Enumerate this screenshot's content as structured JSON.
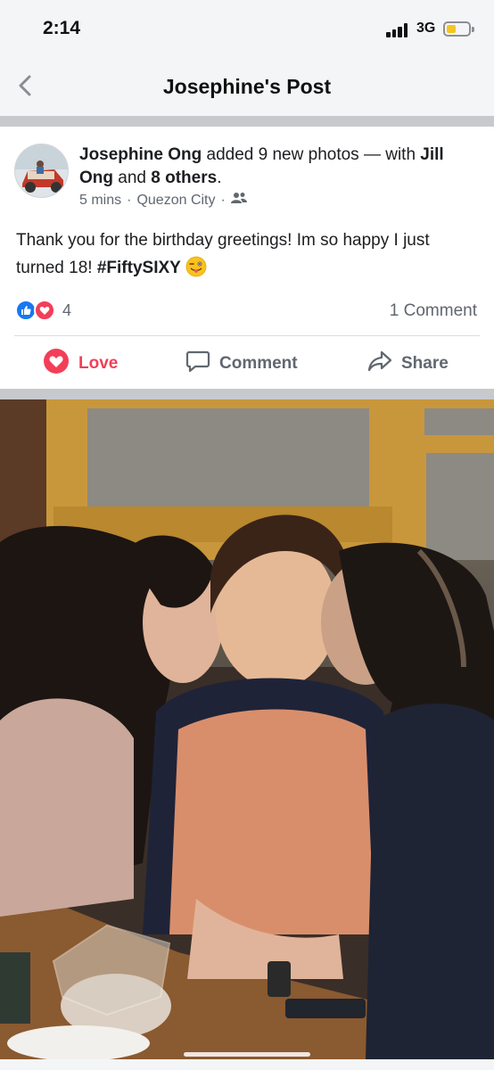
{
  "status": {
    "time": "2:14",
    "network": "3G"
  },
  "nav": {
    "title": "Josephine's Post"
  },
  "post": {
    "author": "Josephine Ong",
    "action_text": " added 9 new photos — with ",
    "tagged": "Jill Ong",
    "and_text": " and ",
    "others": "8 others",
    "period": ".",
    "time": "5 mins",
    "location": "Quezon City",
    "text_main": "Thank you for the birthday greetings! Im so happy I just turned 18! ",
    "hashtag": "#FiftySIXY",
    "reaction_count": "4",
    "comment_count": "1 Comment",
    "actions": {
      "love": "Love",
      "comment": "Comment",
      "share": "Share"
    }
  },
  "icons": [
    "back-chevron-icon",
    "signal-icon",
    "battery-icon",
    "friends-audience-icon",
    "like-reaction-icon",
    "love-reaction-icon",
    "heart-icon",
    "comment-icon",
    "share-icon",
    "winking-tongue-emoji"
  ],
  "colors": {
    "love": "#f33e58",
    "like": "#1877f2",
    "text_secondary": "#606770"
  }
}
